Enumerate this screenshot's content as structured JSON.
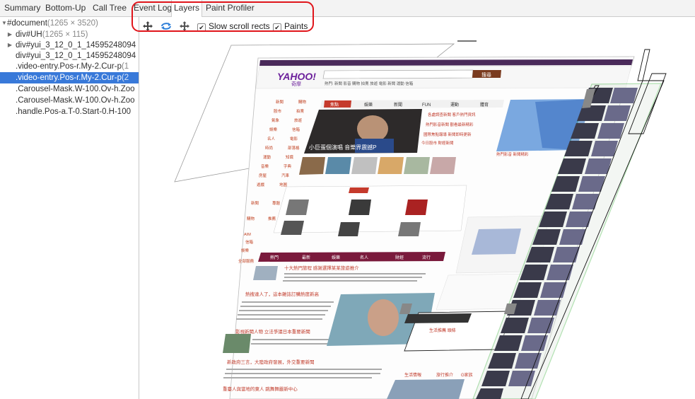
{
  "tabs": [
    {
      "label": "Summary"
    },
    {
      "label": "Bottom-Up"
    },
    {
      "label": "Call Tree"
    },
    {
      "label": "Event Log"
    },
    {
      "label": "Layers"
    },
    {
      "label": "Paint Profiler"
    }
  ],
  "selected_tab": "Layers",
  "toolbar": {
    "pan_tool_icon": "pan-icon",
    "rotate_tool_icon": "rotate-icon",
    "reset_tool_icon": "move-icon",
    "slow_scroll_label": "Slow scroll rects",
    "slow_scroll_checked": true,
    "paints_label": "Paints",
    "paints_checked": true
  },
  "layer_tree": [
    {
      "name": "#document",
      "dims": "(1265 × 3520)",
      "expanded": true,
      "selected": false
    },
    {
      "name": "div#UH",
      "dims": "(1265 × 115)",
      "expanded": false,
      "selected": false
    },
    {
      "name": "div#yui_3_12_0_1_14595248094",
      "dims": "",
      "expanded": false,
      "selected": false
    },
    {
      "name": "div#yui_3_12_0_1_14595248094",
      "dims": "",
      "expanded": null,
      "selected": false
    },
    {
      "name": ".video-entry.Pos-r.My-2.Cur-p",
      "dims": "(1",
      "expanded": null,
      "selected": false
    },
    {
      "name": ".video-entry.Pos-r.My-2.Cur-p",
      "dims": "(2",
      "expanded": null,
      "selected": true
    },
    {
      "name": ".Carousel-Mask.W-100.Ov-h.Zoo",
      "dims": "",
      "expanded": null,
      "selected": false
    },
    {
      "name": ".Carousel-Mask.W-100.Ov-h.Zoo",
      "dims": "",
      "expanded": null,
      "selected": false
    },
    {
      "name": ".handle.Pos-a.T-0.Start-0.H-100",
      "dims": "",
      "expanded": null,
      "selected": false
    }
  ],
  "page_preview": {
    "logo_text": "YAHOO!",
    "logo_sub": "奇摩",
    "search_button": "搜尋",
    "news_tabs": [
      "焦點",
      "娛樂",
      "新聞",
      "FUN",
      "運動",
      "體育"
    ],
    "headline_caption": "小巨蛋個演唱 音樂界震撼P",
    "section_tabs": [
      "熱門",
      "最新",
      "娛樂",
      "名人",
      "財經",
      "流行"
    ],
    "news_lines": [
      "十大熱門旅程 感謝選擇某某旅遊推介",
      "熱搜達人了，這本雜誌訂購熱度新高",
      "影視新聞人物 立法爭議日本重要新聞",
      "新政府三言，大陸政府發展，外交重要新聞",
      "重臺人與當地的東人 跳舞舞嚴新中心"
    ],
    "side_tabs": [
      "生活情報",
      "旅行推介",
      "G家族"
    ]
  },
  "colors": {
    "accent": "#3879d9",
    "highlight": "#e0151b",
    "yahoo_purple": "#400090",
    "layer_green": "#22aa22"
  }
}
